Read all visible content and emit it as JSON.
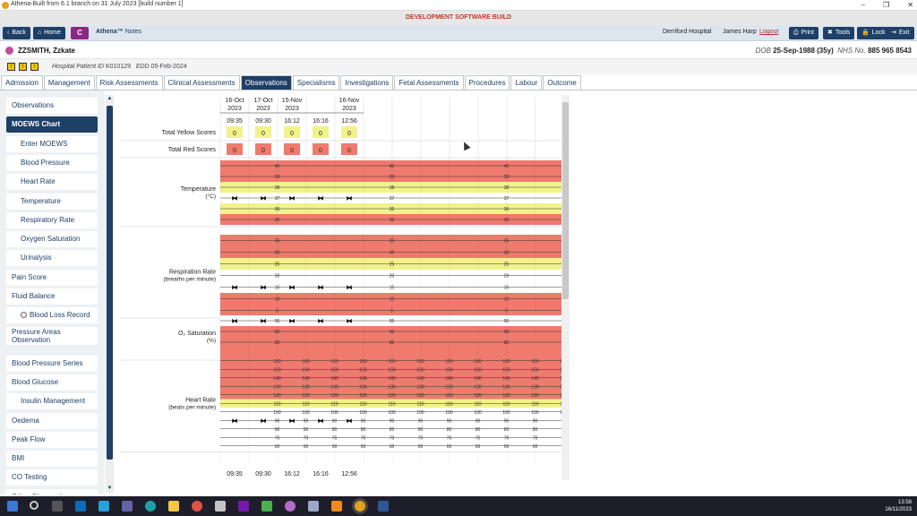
{
  "window": {
    "title": "Athena-Built from 6.1 branch on 31 July 2023 [build number 1]",
    "minimize": "–",
    "restore": "❐",
    "close": "✕"
  },
  "banner": {
    "text": "DEVELOPMENT SOFTWARE BUILD"
  },
  "nav": {
    "back": "Back",
    "home": "Home",
    "c_button": "C",
    "app_name": "Athena™",
    "app_module": "Notes",
    "hospital": "Derriford Hospital",
    "user": "James Harp",
    "logout": "Logout",
    "print": "Print",
    "tools": "Tools",
    "lock": "Lock",
    "exit": "Exit"
  },
  "patient": {
    "name": "ZZSMITH, Zzkate",
    "dob_label": "DOB",
    "dob": "25-Sep-1988 (35y)",
    "nhs_label": "NHS No.",
    "nhs": "885 965 8543",
    "hpid_label": "Hospital Patient ID",
    "hpid": "K010129",
    "edd_label": "EDD",
    "edd": "05-Feb-2024",
    "badges": [
      "!",
      "!",
      "!"
    ]
  },
  "tabs": [
    "Admission",
    "Management",
    "Risk Assessments",
    "Clinical Assessments",
    "Observations",
    "Specialisms",
    "Investigations",
    "Fetal Assessments",
    "Procedures",
    "Labour",
    "Outcome"
  ],
  "active_tab": "Observations",
  "sidebar": [
    {
      "label": "Observations",
      "type": "main"
    },
    {
      "label": "MOEWS Chart",
      "type": "selected"
    },
    {
      "label": "Enter MOEWS",
      "type": "sub"
    },
    {
      "label": "Blood Pressure",
      "type": "sub"
    },
    {
      "label": "Heart Rate",
      "type": "sub"
    },
    {
      "label": "Temperature",
      "type": "sub"
    },
    {
      "label": "Respiratory Rate",
      "type": "sub"
    },
    {
      "label": "Oxygen Saturation",
      "type": "sub"
    },
    {
      "label": "Urinalysis",
      "type": "sub"
    },
    {
      "label": "Pain Score",
      "type": "main"
    },
    {
      "label": "Fluid Balance",
      "type": "main"
    },
    {
      "label": "Blood Loss Record",
      "type": "radio"
    },
    {
      "label": "Pressure Areas Observation",
      "type": "two"
    },
    {
      "label": "Blood Pressure Series",
      "type": "main"
    },
    {
      "label": "Blood Glucose",
      "type": "main"
    },
    {
      "label": "Insulin Management",
      "type": "sub"
    },
    {
      "label": "Oedema",
      "type": "main"
    },
    {
      "label": "Peak Flow",
      "type": "main"
    },
    {
      "label": "BMI",
      "type": "main"
    },
    {
      "label": "CO Testing",
      "type": "main"
    },
    {
      "label": "Other Observations",
      "type": "main"
    }
  ],
  "moews": {
    "columns": [
      {
        "date": [
          "16-Oct",
          "2023"
        ],
        "time": "09:35"
      },
      {
        "date": [
          "17-Oct",
          "2023"
        ],
        "time": "09:30"
      },
      {
        "date": [
          "15-Nov",
          "2023"
        ],
        "time": "16:12"
      },
      {
        "date": [
          "",
          ""
        ],
        "time": "16:16"
      },
      {
        "date": [
          "16-Nov",
          "2023"
        ],
        "time": "12:56"
      }
    ],
    "yellow_label": "Total Yellow Scores",
    "red_label": "Total Red Scores",
    "yellow_scores": [
      "0",
      "0",
      "0",
      "0",
      "0"
    ],
    "red_scores": [
      "0",
      "0",
      "0",
      "0",
      "0"
    ],
    "temperature": {
      "label": "Temperature",
      "unit": "(°C)",
      "ticks": [
        "40",
        "39",
        "38",
        "37",
        "36",
        "35"
      ],
      "zones": [
        "red",
        "red",
        "yellow",
        "white",
        "yellow",
        "red"
      ],
      "value_row": 3
    },
    "respiration": {
      "label": "Respiration Rate",
      "unit": "(breaths per minute)",
      "ticks": [
        "35",
        "30",
        "25",
        "20",
        "15",
        "10",
        "5"
      ],
      "zones": [
        "red",
        "red",
        "yellow",
        "white",
        "white",
        "red",
        "red"
      ],
      "value_row": 4
    },
    "o2": {
      "label": "O₂ Saturation",
      "unit": "(%)",
      "ticks": [
        "95",
        "90",
        "85"
      ],
      "zones": [
        "white",
        "red",
        "red",
        "red"
      ],
      "value_row": 0
    },
    "heart": {
      "label": "Heart Rate",
      "unit": "(beats per minute)",
      "ticks": [
        "160",
        "150",
        "140",
        "130",
        "120",
        "110",
        "100",
        "90",
        "80",
        "70",
        "60"
      ],
      "zones": [
        "red",
        "red",
        "red",
        "red",
        "red",
        "yellow",
        "white",
        "white",
        "white",
        "white",
        "white"
      ],
      "value_row": 7
    },
    "colors": {
      "red": "#ef7a6e",
      "yellow": "#f2f28a",
      "white": "#ffffff",
      "score_yellow": "#f2f28a",
      "score_red": "#ef7a6e"
    }
  },
  "taskbar": {
    "time": "13:58",
    "date": "16/11/2023"
  }
}
